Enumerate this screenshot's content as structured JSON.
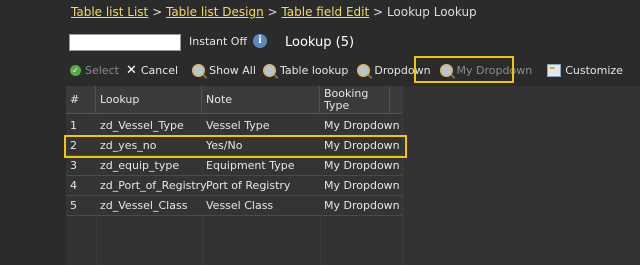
{
  "breadcrumb": {
    "items": [
      "Table list List",
      "Table list Design",
      "Table field Edit"
    ],
    "separator": ">",
    "current": "Lookup Lookup"
  },
  "search": {
    "value": "",
    "placeholder": ""
  },
  "instant_label": "Instant Off",
  "info_icon_glyph": "i",
  "page_title": "Lookup (5)",
  "toolbar": {
    "select_label": "Select",
    "cancel_label": "Cancel",
    "show_all_label": "Show All",
    "table_lookup_label": "Table lookup",
    "dropdown_label": "Dropdown",
    "my_dropdown_label": "My Dropdown",
    "customize_label": "Customize"
  },
  "table": {
    "columns": [
      "#",
      "Lookup",
      "Note",
      "Booking Type"
    ],
    "rows": [
      {
        "num": "1",
        "lookup": "zd_Vessel_Type",
        "note": "Vessel Type",
        "booking_type": "My Dropdown"
      },
      {
        "num": "2",
        "lookup": "zd_yes_no",
        "note": "Yes/No",
        "booking_type": "My Dropdown"
      },
      {
        "num": "3",
        "lookup": "zd_equip_type",
        "note": "Equipment Type",
        "booking_type": "My Dropdown"
      },
      {
        "num": "4",
        "lookup": "zd_Port_of_Registry",
        "note": "Port of Registry",
        "booking_type": "My Dropdown"
      },
      {
        "num": "5",
        "lookup": "zd_Vessel_Class",
        "note": "Vessel Class",
        "booking_type": "My Dropdown"
      }
    ]
  },
  "colors": {
    "background": "#2b2b2b",
    "link": "#f2d96b",
    "highlight": "#f1c40f"
  }
}
